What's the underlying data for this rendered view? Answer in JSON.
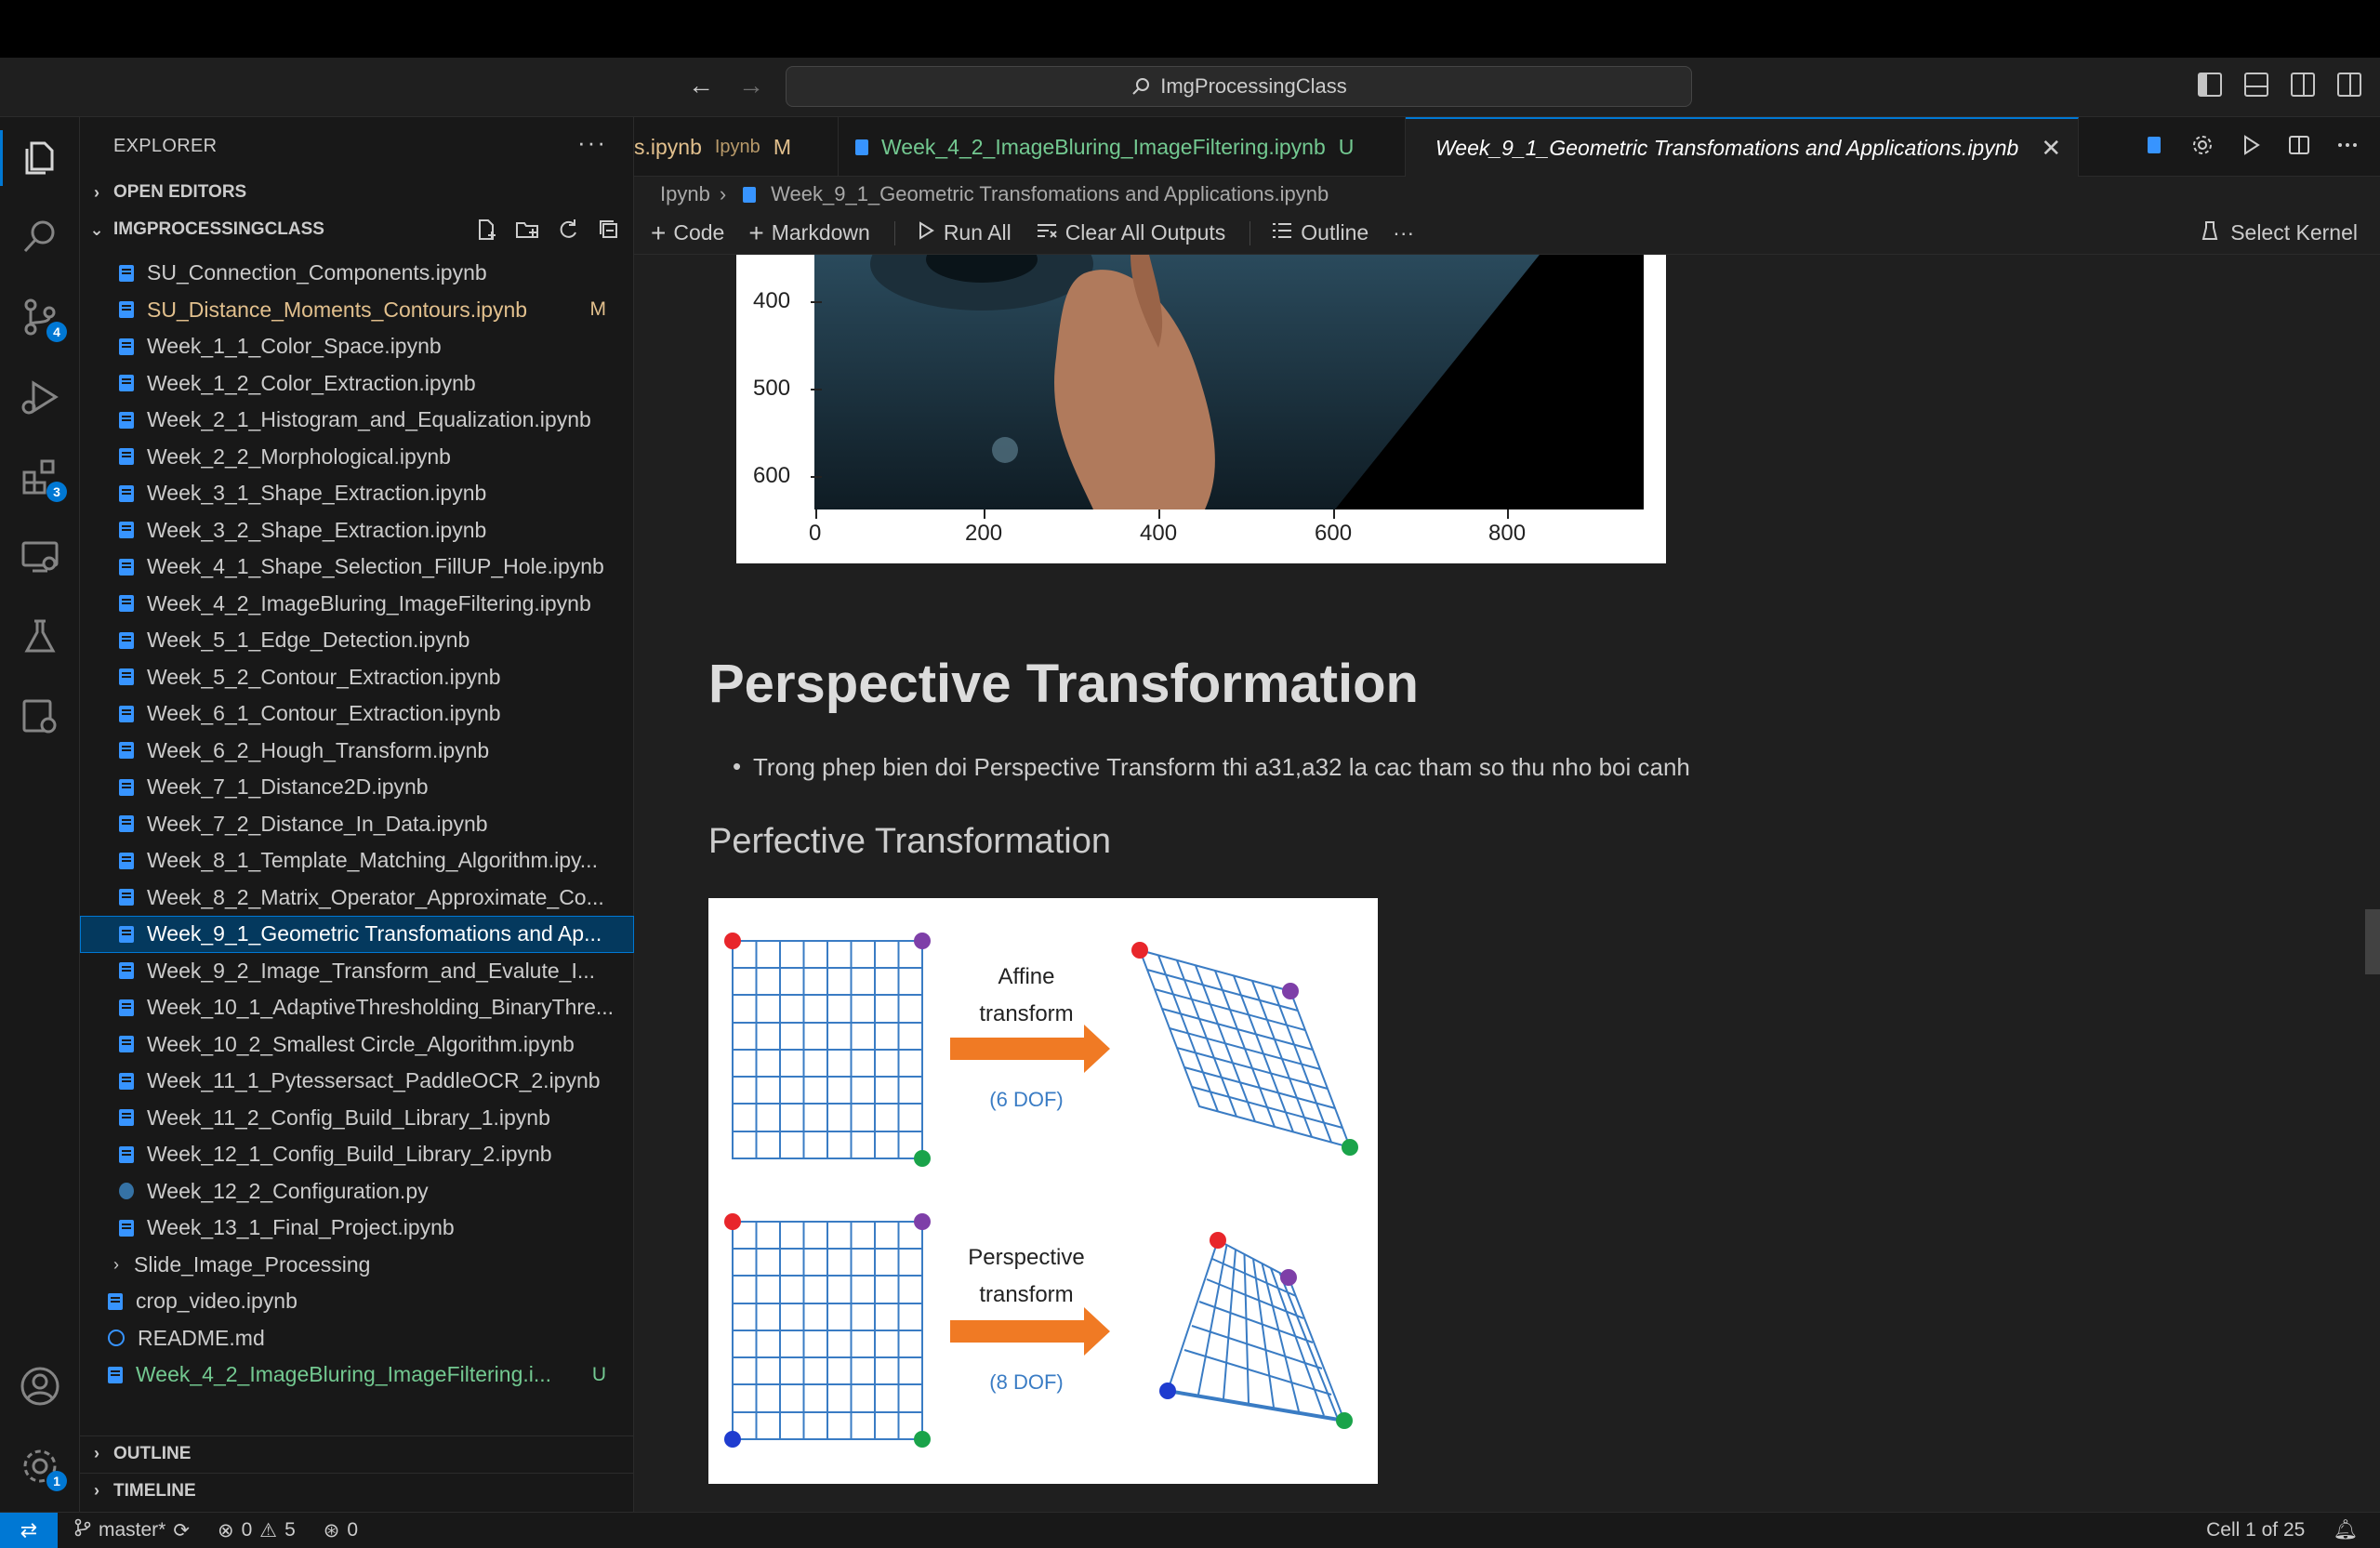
{
  "window": {
    "search_label": "ImgProcessingClass"
  },
  "activity": {
    "scm_badge": "4",
    "extensions_badge": "3",
    "settings_badge": "1"
  },
  "explorer": {
    "title": "EXPLORER",
    "open_editors": "OPEN EDITORS",
    "project": "IMGPROCESSINGCLASS",
    "outline": "OUTLINE",
    "timeline": "TIMELINE",
    "files": [
      {
        "name": "SU_Connection_Components.ipynb",
        "status": ""
      },
      {
        "name": "SU_Distance_Moments_Contours.ipynb",
        "status": "M"
      },
      {
        "name": "Week_1_1_Color_Space.ipynb",
        "status": ""
      },
      {
        "name": "Week_1_2_Color_Extraction.ipynb",
        "status": ""
      },
      {
        "name": "Week_2_1_Histogram_and_Equalization.ipynb",
        "status": ""
      },
      {
        "name": "Week_2_2_Morphological.ipynb",
        "status": ""
      },
      {
        "name": "Week_3_1_Shape_Extraction.ipynb",
        "status": ""
      },
      {
        "name": "Week_3_2_Shape_Extraction.ipynb",
        "status": ""
      },
      {
        "name": "Week_4_1_Shape_Selection_FillUP_Hole.ipynb",
        "status": ""
      },
      {
        "name": "Week_4_2_ImageBluring_ImageFiltering.ipynb",
        "status": ""
      },
      {
        "name": "Week_5_1_Edge_Detection.ipynb",
        "status": ""
      },
      {
        "name": "Week_5_2_Contour_Extraction.ipynb",
        "status": ""
      },
      {
        "name": "Week_6_1_Contour_Extraction.ipynb",
        "status": ""
      },
      {
        "name": "Week_6_2_Hough_Transform.ipynb",
        "status": ""
      },
      {
        "name": "Week_7_1_Distance2D.ipynb",
        "status": ""
      },
      {
        "name": "Week_7_2_Distance_In_Data.ipynb",
        "status": ""
      },
      {
        "name": "Week_8_1_Template_Matching_Algorithm.ipy...",
        "status": ""
      },
      {
        "name": "Week_8_2_Matrix_Operator_Approximate_Co...",
        "status": ""
      },
      {
        "name": "Week_9_1_Geometric Transfomations and Ap...",
        "status": ""
      },
      {
        "name": "Week_9_2_Image_Transform_and_Evalute_I...",
        "status": ""
      },
      {
        "name": "Week_10_1_AdaptiveThresholding_BinaryThre...",
        "status": ""
      },
      {
        "name": "Week_10_2_Smallest Circle_Algorithm.ipynb",
        "status": ""
      },
      {
        "name": "Week_11_1_Pytessersact_PaddleOCR_2.ipynb",
        "status": ""
      },
      {
        "name": "Week_11_2_Config_Build_Library_1.ipynb",
        "status": ""
      },
      {
        "name": "Week_12_1_Config_Build_Library_2.ipynb",
        "status": ""
      },
      {
        "name": "Week_12_2_Configuration.py",
        "status": ""
      },
      {
        "name": "Week_13_1_Final_Project.ipynb",
        "status": ""
      }
    ],
    "folder": "Slide_Image_Processing",
    "root_files": [
      {
        "name": "crop_video.ipynb",
        "status": ""
      },
      {
        "name": "README.md",
        "status": ""
      },
      {
        "name": "Week_4_2_ImageBluring_ImageFiltering.i...",
        "status": "U"
      }
    ]
  },
  "tabs": [
    {
      "name": "s.ipynb",
      "extra": "Ipynb",
      "status": "M"
    },
    {
      "name": "Week_4_2_ImageBluring_ImageFiltering.ipynb",
      "status": "U"
    },
    {
      "name": "Week_9_1_Geometric Transfomations and Applications.ipynb",
      "status": ""
    }
  ],
  "breadcrumb": {
    "part1": "Ipynb",
    "part2": "Week_9_1_Geometric Transfomations and Applications.ipynb"
  },
  "toolbar": {
    "code": "Code",
    "markdown": "Markdown",
    "run_all": "Run All",
    "clear_outputs": "Clear All Outputs",
    "outline": "Outline",
    "more": "···",
    "kernel": "Select Kernel"
  },
  "plot": {
    "yticks": [
      "400",
      "500",
      "600"
    ],
    "xticks": [
      "0",
      "200",
      "400",
      "600",
      "800"
    ]
  },
  "notebook": {
    "heading": "Perspective Transformation",
    "bullet": "Trong phep bien doi Perspective Transform thi a31,a32 la cac tham so thu nho boi canh",
    "subheading": "Perfective Transformation"
  },
  "figure": {
    "affine_line1": "Affine",
    "affine_line2": "transform",
    "affine_dof": "(6 DOF)",
    "persp_line1": "Perspective",
    "persp_line2": "transform",
    "persp_dof": "(8 DOF)"
  },
  "status": {
    "branch": "master*",
    "errors": "0",
    "warnings": "5",
    "ports": "0",
    "cell": "Cell 1 of 25"
  }
}
